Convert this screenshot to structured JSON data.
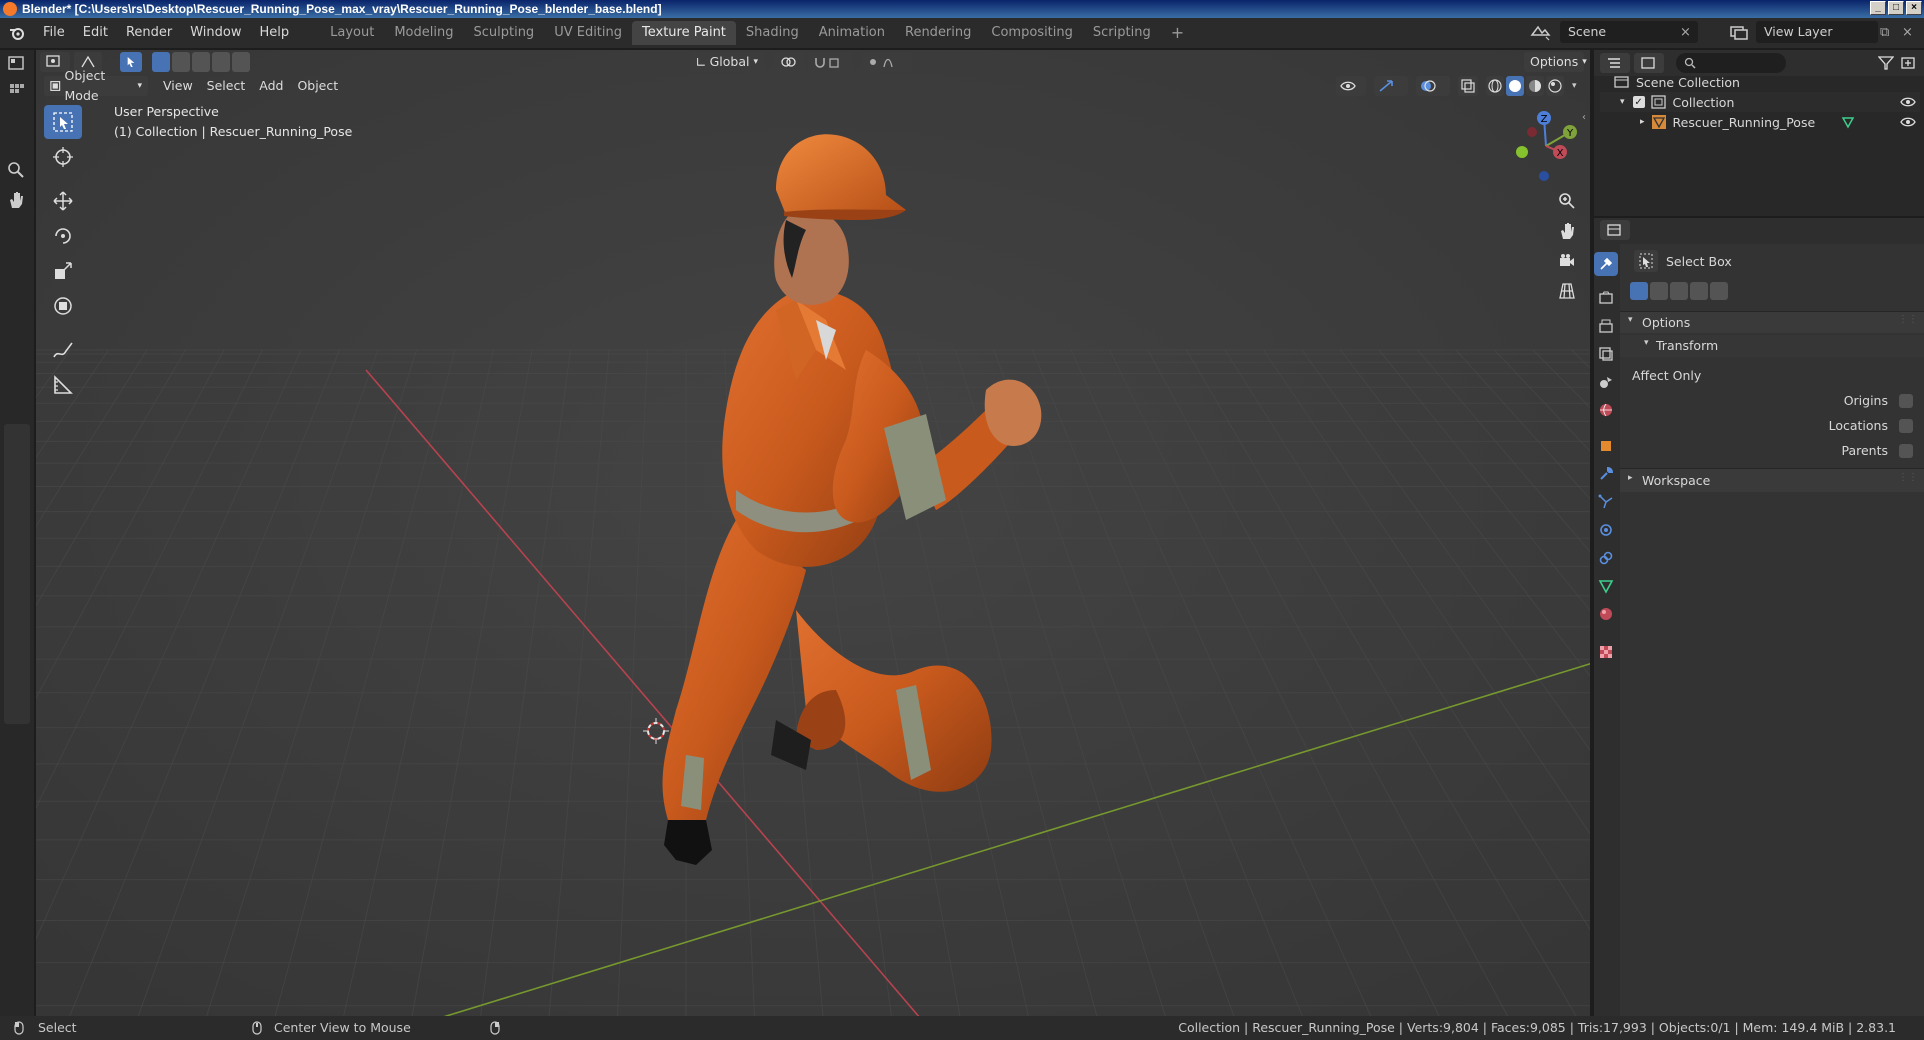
{
  "window": {
    "title": "Blender* [C:\\Users\\rs\\Desktop\\Rescuer_Running_Pose_max_vray\\Rescuer_Running_Pose_blender_base.blend]",
    "controls": [
      "_",
      "□",
      "×"
    ]
  },
  "menu": [
    "File",
    "Edit",
    "Render",
    "Window",
    "Help"
  ],
  "workspaces": [
    {
      "label": "Layout",
      "active": false
    },
    {
      "label": "Modeling",
      "active": false
    },
    {
      "label": "Sculpting",
      "active": false
    },
    {
      "label": "UV Editing",
      "active": false
    },
    {
      "label": "Texture Paint",
      "active": true
    },
    {
      "label": "Shading",
      "active": false
    },
    {
      "label": "Animation",
      "active": false
    },
    {
      "label": "Rendering",
      "active": false
    },
    {
      "label": "Compositing",
      "active": false
    },
    {
      "label": "Scripting",
      "active": false
    }
  ],
  "add_workspace": "+",
  "scene": {
    "name": "Scene"
  },
  "view_layer": {
    "name": "View Layer"
  },
  "viewport": {
    "transform_orientation": "Global",
    "options_label": "Options",
    "mode": "Object Mode",
    "header_menus": [
      "View",
      "Select",
      "Add",
      "Object"
    ],
    "overlay_line1": "User Perspective",
    "overlay_line2": "(1) Collection | Rescuer_Running_Pose",
    "gizmo": {
      "z": "Z",
      "y": "Y",
      "x": "X"
    }
  },
  "outliner": {
    "root": "Scene Collection",
    "collection": "Collection",
    "object": "Rescuer_Running_Pose"
  },
  "properties": {
    "tool_name": "Select Box",
    "options_panel": "Options",
    "transform_panel": "Transform",
    "affect_only": "Affect Only",
    "checkboxes": [
      "Origins",
      "Locations",
      "Parents"
    ],
    "workspace_panel": "Workspace"
  },
  "statusbar": {
    "left_action": "Select",
    "middle_action": "Center View to Mouse",
    "stats": "Collection | Rescuer_Running_Pose | Verts:9,804 | Faces:9,085 | Tris:17,993 | Objects:0/1 | Mem: 149.4 MiB | 2.83.1"
  },
  "colors": {
    "accent": "#4772b3",
    "viewport_bg": "#3d3d3d",
    "suit": "#d35a1e",
    "x_axis": "#c04b58",
    "y_axis": "#7fa33a"
  }
}
